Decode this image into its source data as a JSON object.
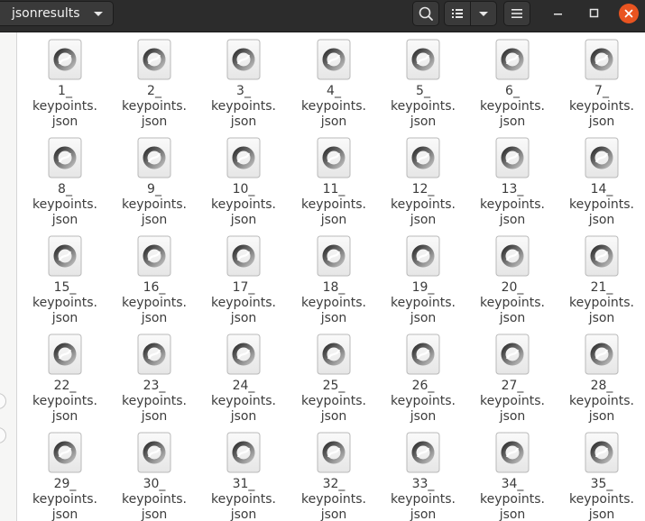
{
  "header": {
    "path_label": "jsonresults",
    "icons": {
      "path_dropdown": "chevron-down-icon",
      "search": "search-icon",
      "list_view": "list-view-icon",
      "view_options": "chevron-down-icon",
      "menu": "hamburger-menu-icon",
      "minimize": "minimize-icon",
      "maximize": "maximize-icon",
      "close": "close-icon"
    }
  },
  "colors": {
    "headerbar": "#2c2c2c",
    "close_button": "#e95420",
    "file_text": "#3c3c3c"
  },
  "file_icon": "json-file-icon",
  "files": [
    {
      "number": "1_",
      "word": "keypoints.",
      "ext": "json"
    },
    {
      "number": "2_",
      "word": "keypoints.",
      "ext": "json"
    },
    {
      "number": "3_",
      "word": "keypoints.",
      "ext": "json"
    },
    {
      "number": "4_",
      "word": "keypoints.",
      "ext": "json"
    },
    {
      "number": "5_",
      "word": "keypoints.",
      "ext": "json"
    },
    {
      "number": "6_",
      "word": "keypoints.",
      "ext": "json"
    },
    {
      "number": "7_",
      "word": "keypoints.",
      "ext": "json"
    },
    {
      "number": "8_",
      "word": "keypoints.",
      "ext": "json"
    },
    {
      "number": "9_",
      "word": "keypoints.",
      "ext": "json"
    },
    {
      "number": "10_",
      "word": "keypoints.",
      "ext": "json"
    },
    {
      "number": "11_",
      "word": "keypoints.",
      "ext": "json"
    },
    {
      "number": "12_",
      "word": "keypoints.",
      "ext": "json"
    },
    {
      "number": "13_",
      "word": "keypoints.",
      "ext": "json"
    },
    {
      "number": "14_",
      "word": "keypoints.",
      "ext": "json"
    },
    {
      "number": "15_",
      "word": "keypoints.",
      "ext": "json"
    },
    {
      "number": "16_",
      "word": "keypoints.",
      "ext": "json"
    },
    {
      "number": "17_",
      "word": "keypoints.",
      "ext": "json"
    },
    {
      "number": "18_",
      "word": "keypoints.",
      "ext": "json"
    },
    {
      "number": "19_",
      "word": "keypoints.",
      "ext": "json"
    },
    {
      "number": "20_",
      "word": "keypoints.",
      "ext": "json"
    },
    {
      "number": "21_",
      "word": "keypoints.",
      "ext": "json"
    },
    {
      "number": "22_",
      "word": "keypoints.",
      "ext": "json"
    },
    {
      "number": "23_",
      "word": "keypoints.",
      "ext": "json"
    },
    {
      "number": "24_",
      "word": "keypoints.",
      "ext": "json"
    },
    {
      "number": "25_",
      "word": "keypoints.",
      "ext": "json"
    },
    {
      "number": "26_",
      "word": "keypoints.",
      "ext": "json"
    },
    {
      "number": "27_",
      "word": "keypoints.",
      "ext": "json"
    },
    {
      "number": "28_",
      "word": "keypoints.",
      "ext": "json"
    },
    {
      "number": "29_",
      "word": "keypoints.",
      "ext": "json"
    },
    {
      "number": "30_",
      "word": "keypoints.",
      "ext": "json"
    },
    {
      "number": "31_",
      "word": "keypoints.",
      "ext": "json"
    },
    {
      "number": "32_",
      "word": "keypoints.",
      "ext": "json"
    },
    {
      "number": "33_",
      "word": "keypoints.",
      "ext": "json"
    },
    {
      "number": "34_",
      "word": "keypoints.",
      "ext": "json"
    },
    {
      "number": "35_",
      "word": "keypoints.",
      "ext": "json"
    }
  ]
}
